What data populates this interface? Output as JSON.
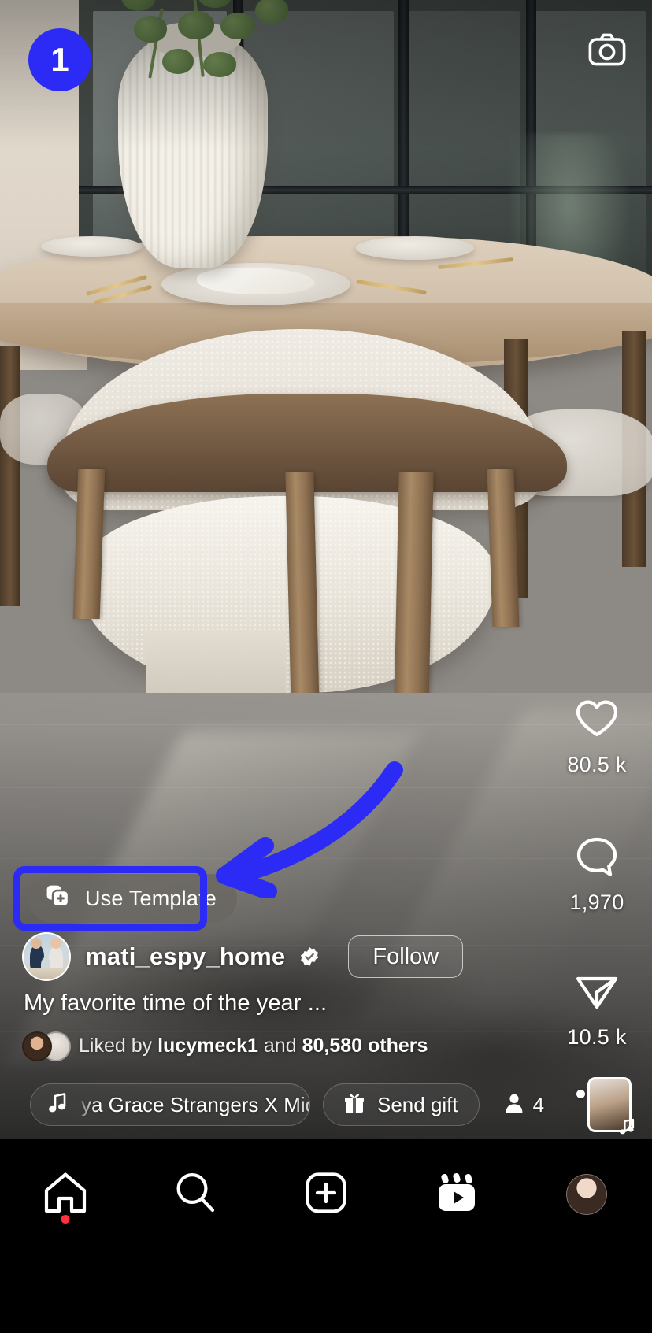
{
  "app": "Instagram Reels",
  "header": {
    "camera_icon": "camera-icon"
  },
  "annotations": {
    "step_number": "1",
    "accent_color": "#2B2BF5",
    "highlight_target": "Use Template",
    "arrow_icon": "curved-arrow-icon"
  },
  "overlay": {
    "use_template": {
      "label": "Use Template",
      "icon": "template-stack-plus-icon"
    },
    "account": {
      "username": "mati_espy_home",
      "verified": true,
      "verified_icon": "verified-badge-icon",
      "avatar_icon": "profile-avatar",
      "follow_label": "Follow"
    },
    "caption": "My favorite time of the year ...",
    "likes_summary": {
      "prefix": "Liked by",
      "primary_user": "lucymeck1",
      "middle": "and",
      "others": "80,580 others"
    },
    "music": {
      "icon": "music-note-icon",
      "title": "ya Grace Strangers X Midnig",
      "thumb_icon": "audio-thumbnail"
    },
    "send_gift": {
      "icon": "gift-icon",
      "label": "Send gift"
    },
    "viewers": {
      "icon": "person-icon",
      "count": "4"
    }
  },
  "actions": [
    {
      "name": "like",
      "icon": "heart-icon",
      "count": "80.5 k"
    },
    {
      "name": "comment",
      "icon": "comment-bubble-icon",
      "count": "1,970"
    },
    {
      "name": "share",
      "icon": "paper-plane-icon",
      "count": "10.5 k"
    },
    {
      "name": "more",
      "icon": "more-horizontal-icon",
      "count": ""
    }
  ],
  "bottom_nav": [
    {
      "name": "home",
      "icon": "home-icon",
      "active": true,
      "badge": true
    },
    {
      "name": "search",
      "icon": "search-icon",
      "active": false,
      "badge": false
    },
    {
      "name": "create",
      "icon": "plus-square-icon",
      "active": false,
      "badge": false
    },
    {
      "name": "reels",
      "icon": "reels-icon",
      "active": false,
      "badge": false
    },
    {
      "name": "profile",
      "icon": "profile-avatar-icon",
      "active": false,
      "badge": false
    }
  ]
}
